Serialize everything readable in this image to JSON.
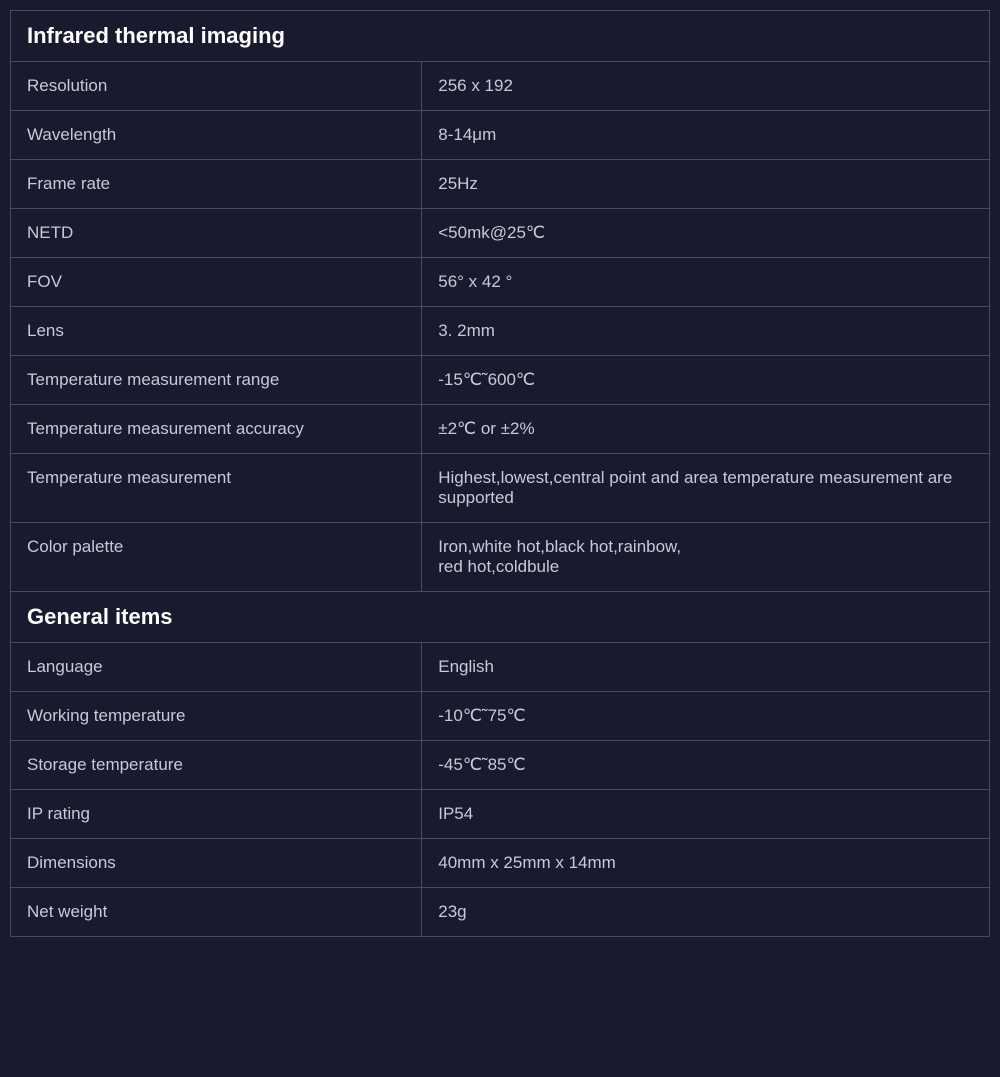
{
  "infrared_section": {
    "title": "Infrared thermal imaging",
    "rows": [
      {
        "label": "Resolution",
        "value": "256 x 192"
      },
      {
        "label": "Wavelength",
        "value": "8-14μm"
      },
      {
        "label": "Frame rate",
        "value": "25Hz"
      },
      {
        "label": "NETD",
        "value": "<50mk@25℃"
      },
      {
        "label": "FOV",
        "value": "56°  x   42  °"
      },
      {
        "label": "Lens",
        "value": "3. 2mm"
      },
      {
        "label": "Temperature measurement range",
        "value": "-15℃˜600℃"
      },
      {
        "label": "Temperature measurement accuracy",
        "value": "±2℃  or  ±2%"
      },
      {
        "label": "Temperature measurement",
        "value": "Highest,lowest,central point and area temperature measurement are supported"
      },
      {
        "label": "Color palette",
        "value": "Iron,white hot,black hot,rainbow,\nred hot,coldbule"
      }
    ]
  },
  "general_section": {
    "title": "General items",
    "rows": [
      {
        "label": "Language",
        "value": "English"
      },
      {
        "label": "Working temperature",
        "value": "-10℃˜75℃"
      },
      {
        "label": "Storage temperature",
        "value": "-45℃˜85℃"
      },
      {
        "label": "IP rating",
        "value": "IP54"
      },
      {
        "label": "Dimensions",
        "value": "40mm  x  25mm  x  14mm"
      },
      {
        "label": "Net weight",
        "value": "23g"
      }
    ]
  }
}
